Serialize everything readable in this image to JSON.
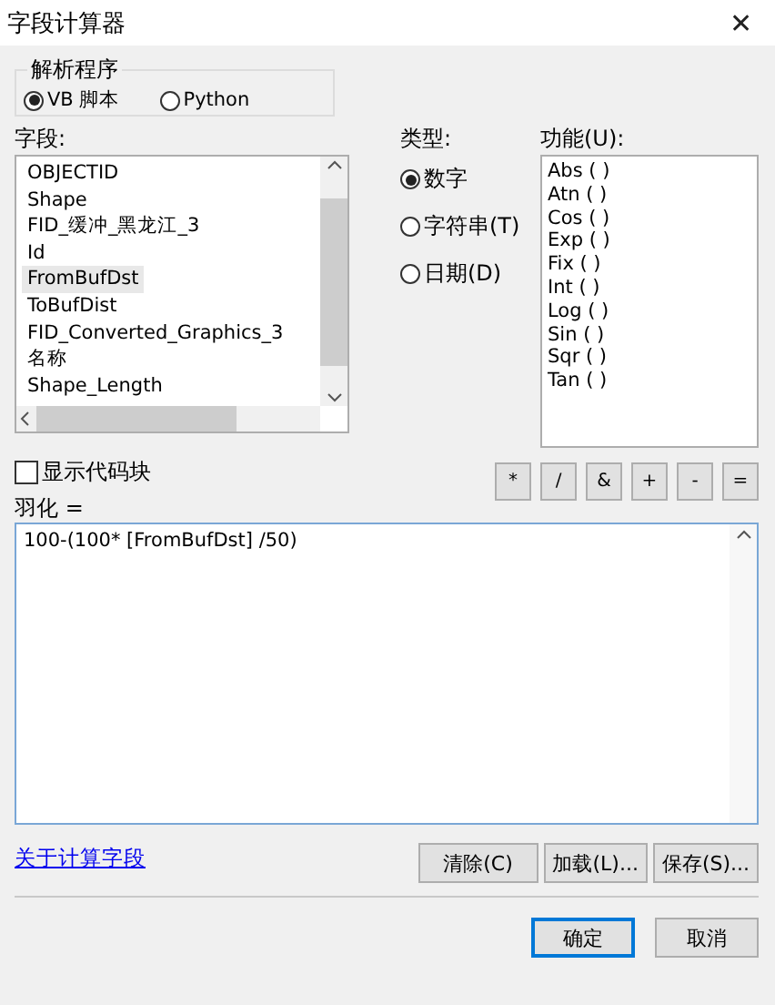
{
  "window": {
    "title": "字段计算器",
    "close": "✕"
  },
  "parser": {
    "label": "解析程序",
    "options": [
      {
        "label": "VB 脚本",
        "selected": true
      },
      {
        "label": "Python",
        "selected": false
      }
    ]
  },
  "fields": {
    "label": "字段:",
    "items": [
      {
        "name": "OBJECTID",
        "selected": false
      },
      {
        "name": "Shape",
        "selected": false
      },
      {
        "name": "FID_缓冲_黑龙江_3",
        "selected": false
      },
      {
        "name": "Id",
        "selected": false
      },
      {
        "name": "FromBufDst",
        "selected": true
      },
      {
        "name": "ToBufDist",
        "selected": false
      },
      {
        "name": "FID_Converted_Graphics_3",
        "selected": false
      },
      {
        "name": "名称",
        "selected": false
      },
      {
        "name": "Shape_Length",
        "selected": false
      }
    ]
  },
  "type": {
    "label": "类型:",
    "options": [
      {
        "label": "数字",
        "selected": true
      },
      {
        "label": "字符串(T)",
        "selected": false
      },
      {
        "label": "日期(D)",
        "selected": false
      }
    ]
  },
  "functions": {
    "label": "功能(U):",
    "items": [
      "Abs (  )",
      "Atn (  )",
      "Cos (  )",
      "Exp (  )",
      "Fix (  )",
      "Int (  )",
      "Log (  )",
      "Sin (  )",
      "Sqr (  )",
      "Tan (  )"
    ]
  },
  "show_codeblock": {
    "label": "显示代码块",
    "checked": false
  },
  "operators": [
    "*",
    "/",
    "&",
    "+",
    "-",
    "="
  ],
  "expression": {
    "label": "羽化 =",
    "value": "100-(100* [FromBufDst] /50)"
  },
  "link": "关于计算字段",
  "file_buttons": [
    "清除(C)",
    "加载(L)...",
    "保存(S)..."
  ],
  "dialog_buttons": [
    {
      "label": "确定",
      "default": true
    },
    {
      "label": "取消",
      "default": false
    }
  ]
}
